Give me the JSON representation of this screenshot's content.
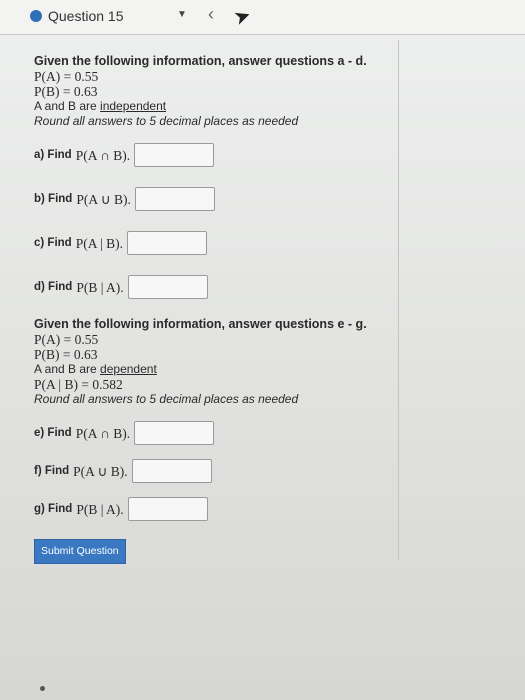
{
  "header": {
    "question_label": "Question 15"
  },
  "part1": {
    "heading": "Given the following information, answer questions a - d.",
    "pa": "P(A) = 0.55",
    "pb": "P(B) = 0.63",
    "independence_prefix": "A and B are ",
    "independence_word": "independent",
    "round_note": "Round all answers to 5 decimal places as needed",
    "questions": [
      {
        "label": "a) Find",
        "expr": "P(A ∩ B)."
      },
      {
        "label": "b) Find",
        "expr": "P(A ∪ B)."
      },
      {
        "label": "c) Find",
        "expr": "P(A | B)."
      },
      {
        "label": "d) Find",
        "expr": "P(B | A)."
      }
    ]
  },
  "part2": {
    "heading": "Given the following information, answer questions e - g.",
    "pa": "P(A) = 0.55",
    "pb": "P(B) = 0.63",
    "dependence_prefix": "A and B are ",
    "dependence_word": "dependent",
    "pab": "P(A | B) = 0.582",
    "round_note": "Round all answers to 5 decimal places as needed",
    "questions": [
      {
        "label": "e) Find",
        "expr": "P(A ∩ B)."
      },
      {
        "label": "f) Find",
        "expr": "P(A ∪ B)."
      },
      {
        "label": "g) Find",
        "expr": "P(B | A)."
      }
    ]
  },
  "submit_label": "Submit Question"
}
